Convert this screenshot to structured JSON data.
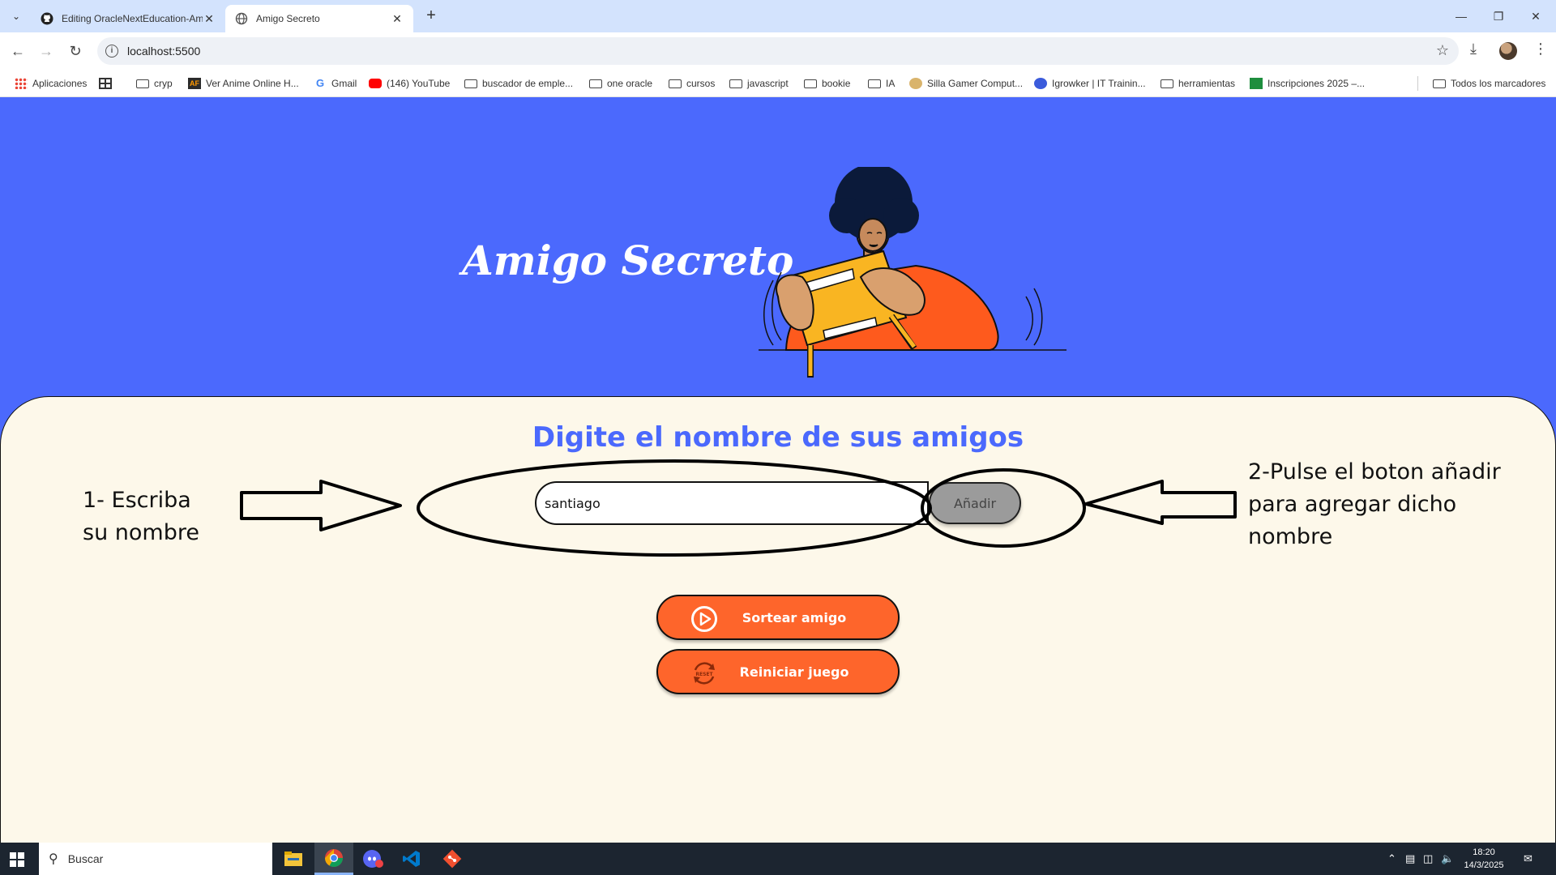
{
  "browser": {
    "tabs": [
      {
        "title": "Editing OracleNextEducation-Am",
        "active": false
      },
      {
        "title": "Amigo Secreto",
        "active": true
      }
    ],
    "url": "localhost:5500",
    "bookmarks": [
      {
        "label": "Aplicaciones",
        "icon": "apps-grid-icon"
      },
      {
        "label": "",
        "icon": "grid-icon"
      },
      {
        "label": "cryp",
        "icon": "folder-icon"
      },
      {
        "label": "Ver Anime Online H...",
        "icon": "anime-site-icon"
      },
      {
        "label": "Gmail",
        "icon": "google-icon"
      },
      {
        "label": "(146) YouTube",
        "icon": "youtube-icon"
      },
      {
        "label": "buscador de emple...",
        "icon": "folder-icon"
      },
      {
        "label": "one oracle",
        "icon": "folder-icon"
      },
      {
        "label": "cursos",
        "icon": "folder-icon"
      },
      {
        "label": "javascript",
        "icon": "folder-icon"
      },
      {
        "label": "bookie",
        "icon": "folder-icon"
      },
      {
        "label": "IA",
        "icon": "folder-icon"
      },
      {
        "label": "Silla Gamer Comput...",
        "icon": "chair-site-icon"
      },
      {
        "label": "Igrowker | IT Trainin...",
        "icon": "igrowker-icon"
      },
      {
        "label": "herramientas",
        "icon": "folder-icon"
      },
      {
        "label": "Inscripciones 2025 –...",
        "icon": "sheets-icon"
      }
    ],
    "all_bookmarks": "Todos los marcadores",
    "colors": {
      "tabbar": "#d3e3fd",
      "toolbar": "#ffffff"
    }
  },
  "page": {
    "title": "Amigo Secreto",
    "section_title": "Digite el nombre de sus amigos",
    "input_value": "santiago",
    "add_button": "Añadir",
    "draw_button": "Sortear amigo",
    "reset_button": "Reiniciar juego",
    "reset_icon_text": "RESET",
    "colors": {
      "primary": "#4b69fd",
      "accent": "#fe652b",
      "panel": "#fdf8ea",
      "add_button": "#9b9b9b"
    }
  },
  "annotations": {
    "step1": [
      "1- Escriba",
      "su nombre"
    ],
    "step2": [
      "2-Pulse el boton añadir",
      "para agregar dicho",
      "nombre"
    ]
  },
  "taskbar": {
    "search_placeholder": "Buscar",
    "apps": [
      "file-explorer-icon",
      "chrome-icon",
      "discord-icon",
      "vscode-icon",
      "git-icon"
    ],
    "time": "18:20",
    "date": "14/3/2025"
  }
}
